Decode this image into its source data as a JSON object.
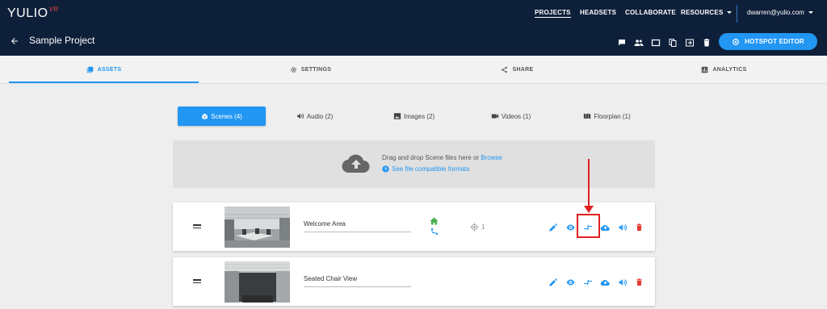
{
  "brand": {
    "name": "YULIO",
    "badge": "VR"
  },
  "nav": {
    "projects": "PROJECTS",
    "headsets": "HEADSETS",
    "collaborate": "COLLABORATE",
    "resources": "RESOURCES",
    "user": "dwarren@yulio.com"
  },
  "project": {
    "title": "Sample Project",
    "hotspot_editor": "HOTSPOT EDITOR"
  },
  "tabs": {
    "assets": "ASSETS",
    "settings": "SETTINGS",
    "share": "SHARE",
    "analytics": "ANALYTICS"
  },
  "filters": {
    "scenes": "Scenes (4)",
    "audio": "Audio (2)",
    "images": "Images (2)",
    "videos": "Videos (1)",
    "floorplan": "Floorplan (1)"
  },
  "dropzone": {
    "text": "Drag and drop Scene files here or ",
    "browse": "Browse",
    "help": "See file compatible formats"
  },
  "scenes": [
    {
      "name": "Welcome Area",
      "hotspots": "1"
    },
    {
      "name": "Seated Chair View"
    }
  ],
  "colors": {
    "navy": "#0e1f3a",
    "accent": "#2196f3",
    "delete": "#e53935",
    "home_green": "#4caf50",
    "annotation_red": "#e02020"
  }
}
